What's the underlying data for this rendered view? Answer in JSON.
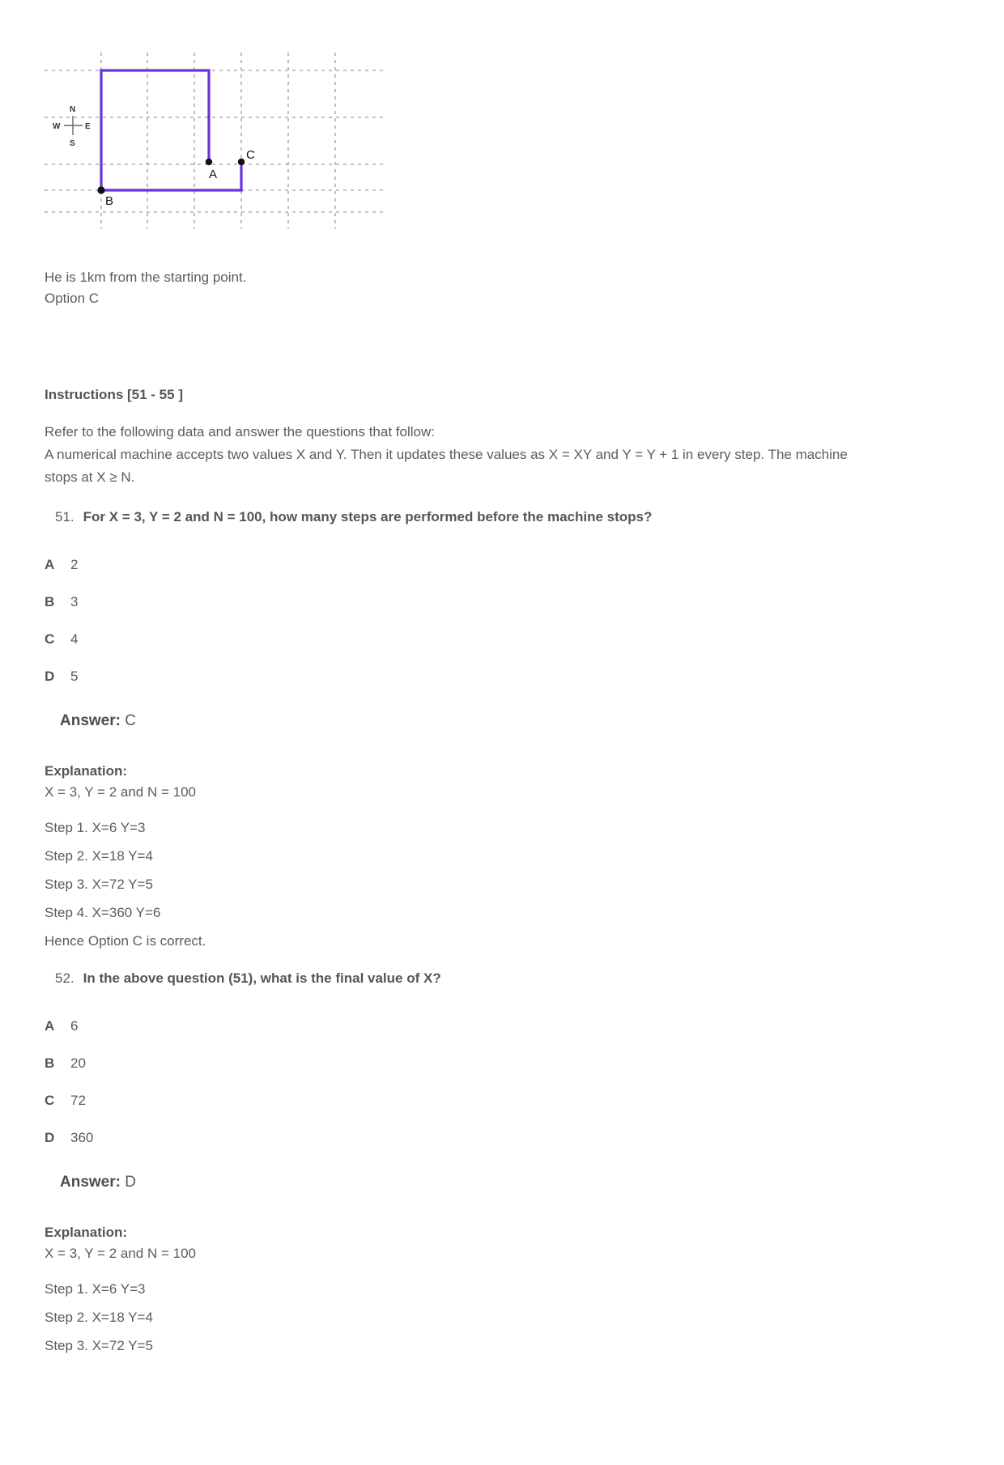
{
  "figure": {
    "caption_lines": [
      "He is 1km from the starting point.",
      "Option C"
    ],
    "compass": {
      "north": "N",
      "south": "S",
      "east": "E",
      "west": "W"
    },
    "points": [
      {
        "label": "A"
      },
      {
        "label": "B"
      },
      {
        "label": "C"
      }
    ],
    "path_color": "#6633dd",
    "grid_color": "#7a7a7a",
    "point_color": "#000000"
  },
  "instructions": {
    "heading": "Instructions [51 - 55 ]",
    "paragraph_lines": [
      "Refer to the following data and answer the questions that follow:",
      "A numerical machine accepts two values X and Y. Then it updates these values as X = XY and Y = Y + 1 in every step. The machine",
      "stops at X ≥ N."
    ]
  },
  "questions": [
    {
      "number": "51.",
      "text": "For X = 3, Y = 2 and N = 100, how many steps are performed before the machine stops?",
      "options": [
        {
          "letter": "A",
          "value": "2"
        },
        {
          "letter": "B",
          "value": "3"
        },
        {
          "letter": "C",
          "value": "4"
        },
        {
          "letter": "D",
          "value": "5"
        }
      ],
      "answer_label": "Answer:",
      "answer_value": "C",
      "explanation_label": "Explanation:",
      "explanation_lines": [
        "X = 3, Y = 2 and N = 100"
      ],
      "explanation_steps": [
        "Step 1. X=6 Y=3",
        "Step 2. X=18 Y=4",
        "Step 3. X=72 Y=5",
        "Step 4. X=360 Y=6",
        "Hence Option C is correct."
      ]
    },
    {
      "number": "52.",
      "text": "In the above question (51), what is the final value of X?",
      "options": [
        {
          "letter": "A",
          "value": "6"
        },
        {
          "letter": "B",
          "value": "20"
        },
        {
          "letter": "C",
          "value": "72"
        },
        {
          "letter": "D",
          "value": "360"
        }
      ],
      "answer_label": "Answer:",
      "answer_value": "D",
      "explanation_label": "Explanation:",
      "explanation_lines": [
        "X = 3, Y = 2 and N = 100"
      ],
      "explanation_steps": [
        "Step 1. X=6 Y=3",
        "Step 2. X=18 Y=4",
        "Step 3. X=72 Y=5"
      ]
    }
  ]
}
